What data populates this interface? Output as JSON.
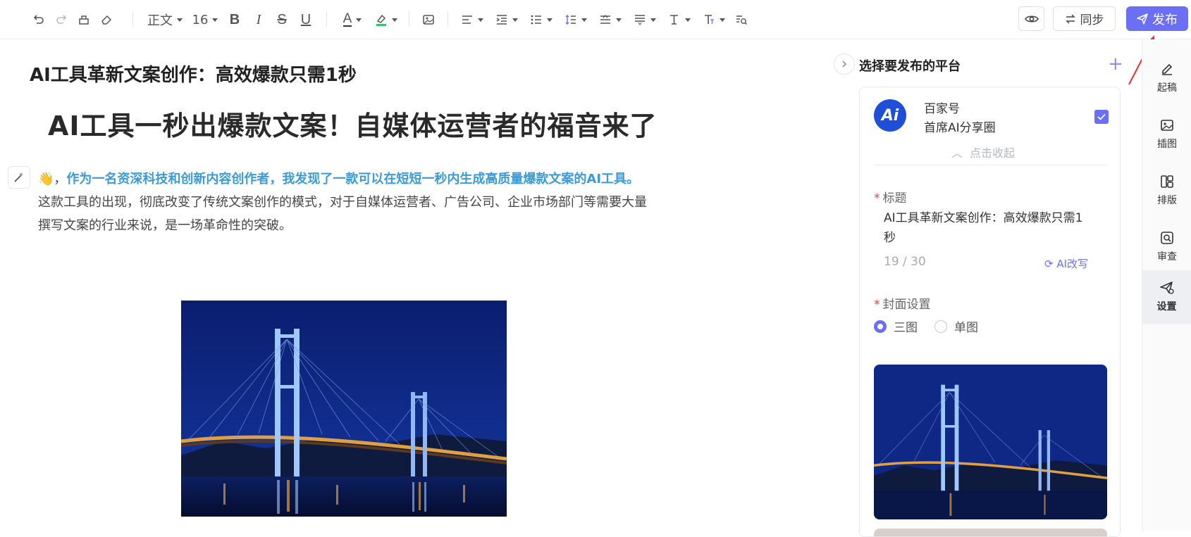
{
  "toolbar": {
    "paragraph_style": "正文",
    "font_size": "16",
    "preview_icon": "eye-icon",
    "sync_label": "同步",
    "publish_label": "发布"
  },
  "editor": {
    "doc_title": "AI工具革新文案创作：高效爆款只需1秒",
    "heading": "AI工具一秒出爆款文案！自媒体运营者的福音来了",
    "para_emoji": "👋，",
    "para_highlight": "作为一名资深科技和创新内容创作者，我发现了一款可以在短短一秒内生成高质量爆款文案的AI工具。",
    "para_rest": "这款工具的出现，彻底改变了传统文案创作的模式，对于自媒体运营者、广告公司、企业市场部门等需要大量撰写文案的行业来说，是一场革命性的突破。"
  },
  "panel": {
    "title": "选择要发布的平台",
    "platform": {
      "avatar_text": "Ai",
      "name": "百家号",
      "account": "首席AI分享圈",
      "checked": true,
      "collapse_label": "点击收起"
    },
    "title_field": {
      "label": "标题",
      "value": "AI工具革新文案创作：高效爆款只需1秒",
      "counter": "19 / 30",
      "ai_rewrite": "AI改写"
    },
    "cover_field": {
      "label": "封面设置",
      "options": [
        "三图",
        "单图"
      ],
      "selected": "三图"
    }
  },
  "rail": {
    "items": [
      {
        "label": "起稿",
        "icon": "pen-icon"
      },
      {
        "label": "插图",
        "icon": "image-icon"
      },
      {
        "label": "排版",
        "icon": "layout-icon"
      },
      {
        "label": "审查",
        "icon": "review-icon"
      },
      {
        "label": "设置",
        "icon": "send-settings-icon"
      }
    ],
    "active": "设置"
  },
  "colors": {
    "accent": "#6b6ff5",
    "highlight_text": "#3a9bd8",
    "required": "#e54545"
  }
}
